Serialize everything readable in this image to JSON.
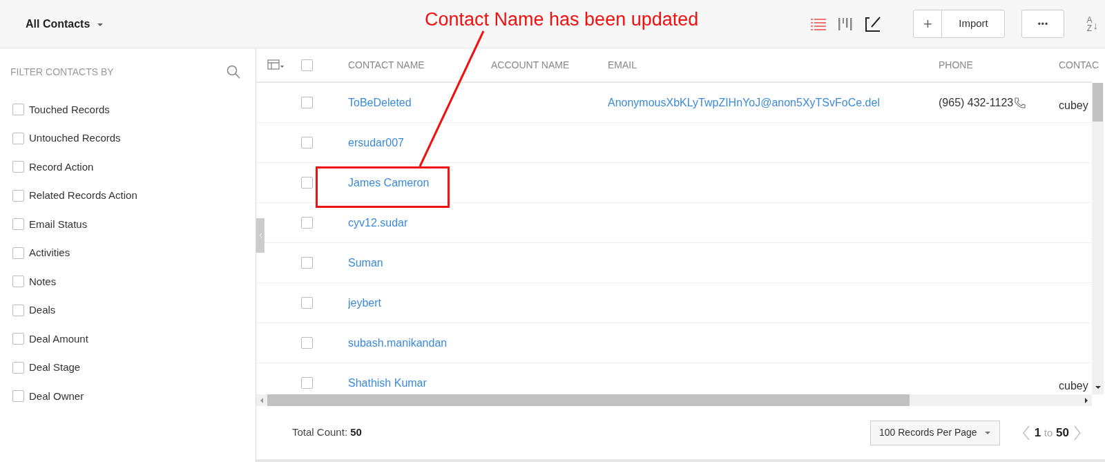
{
  "top_bar": {
    "view_selector": "All Contacts",
    "view_toggles": [
      {
        "kind": "list",
        "selected": true
      },
      {
        "kind": "columns",
        "selected": false
      },
      {
        "kind": "edit",
        "selected": false
      }
    ],
    "add_icon": "+",
    "import_button": "Import",
    "more_button": "•••",
    "sort": {
      "first": "A",
      "last": "Z",
      "arrow": "↓"
    }
  },
  "annotation": {
    "text": "Contact Name has been updated"
  },
  "sidebar": {
    "title": "FILTER CONTACTS BY",
    "filters": [
      {
        "label": "Touched Records",
        "checked": false
      },
      {
        "label": "Untouched Records",
        "checked": false
      },
      {
        "label": "Record Action",
        "checked": false
      },
      {
        "label": "Related Records Action",
        "checked": false
      },
      {
        "label": "Email Status",
        "checked": false
      },
      {
        "label": "Activities",
        "checked": false
      },
      {
        "label": "Notes",
        "checked": false
      },
      {
        "label": "Deals",
        "checked": false
      },
      {
        "label": "Deal Amount",
        "checked": false
      },
      {
        "label": "Deal Stage",
        "checked": false
      },
      {
        "label": "Deal Owner",
        "checked": false
      }
    ]
  },
  "table": {
    "all_checked": false,
    "columns": [
      "CONTACT NAME",
      "ACCOUNT NAME",
      "EMAIL",
      "PHONE",
      "CONTAC"
    ],
    "rows": [
      {
        "checked": false,
        "contact_name": "ToBeDeleted",
        "email": "AnonymousXbKLyTwpZIHnYoJ@anon5XyTSvFoCe.del",
        "phone": "(965) 432-1123",
        "contact": "cubey"
      },
      {
        "checked": false,
        "contact_name": "ersudar007"
      },
      {
        "checked": false,
        "contact_name": "James Cameron",
        "highlighted": true
      },
      {
        "checked": false,
        "contact_name": "cyv12.sudar"
      },
      {
        "checked": false,
        "contact_name": "Suman"
      },
      {
        "checked": false,
        "contact_name": "jeybert"
      },
      {
        "checked": false,
        "contact_name": "subash.manikandan"
      },
      {
        "checked": false,
        "contact_name": "Shathish Kumar",
        "contact": "cubey"
      }
    ]
  },
  "footer": {
    "total_label": "Total Count:",
    "total": "50",
    "per_page": "100 Records Per Page",
    "range_from": "1",
    "range_to_word": "to",
    "range_to": "50"
  }
}
